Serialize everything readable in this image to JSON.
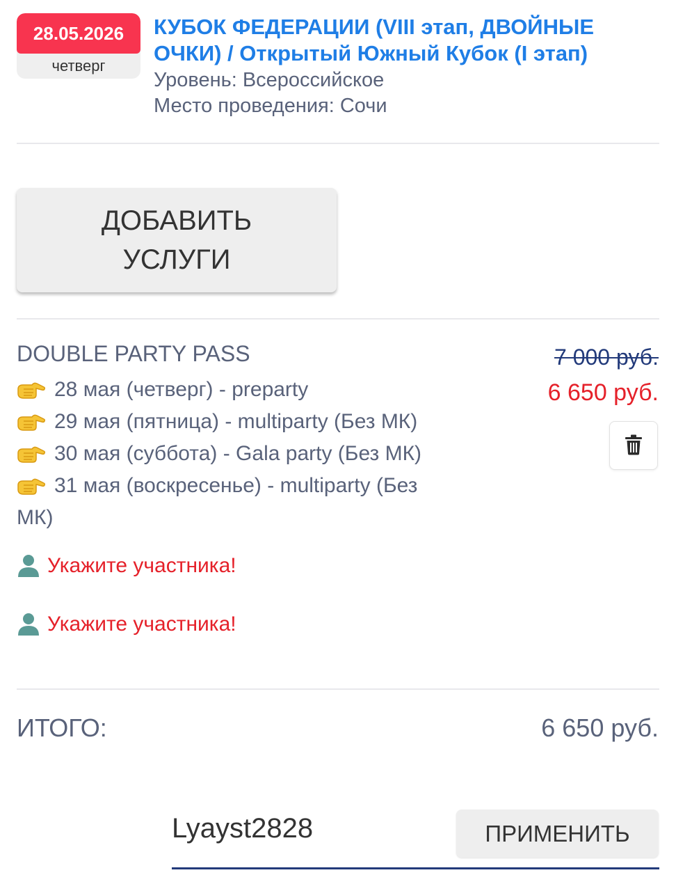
{
  "event": {
    "date": "28.05.2026",
    "weekday": "четверг",
    "title": "КУБОК ФЕДЕРАЦИИ (VIII этап, ДВОЙНЫЕ ОЧКИ) / Открытый Южный Кубок (I этап)",
    "level": "Уровень: Всероссийское",
    "venue": "Место проведения: Сочи",
    "colors": {
      "date_badge": "#f8344f",
      "title": "#1f7ee6"
    }
  },
  "add_services": {
    "label_line1": "ДОБАВИТЬ",
    "label_line2": "УСЛУГИ"
  },
  "item": {
    "name": "DOUBLE PARTY PASS",
    "lines": [
      "28 мая (четверг) - preparty",
      "29 мая (пятница) - multiparty (Без МК)",
      "30 мая (суббота) - Gala party (Без МК)",
      "31 мая (воскресенье) - multiparty (Без",
      "МК)"
    ],
    "line_icon": "pointing-hand-icon",
    "old_price": "7 000 руб.",
    "new_price": "6 650 руб.",
    "delete_icon": "trash-icon",
    "participants": [
      {
        "icon": "person-icon",
        "text": "Укажите участника!"
      },
      {
        "icon": "person-icon",
        "text": "Укажите участника!"
      }
    ],
    "colors": {
      "old_price": "#223a7a",
      "new_price": "#e5212a",
      "warning": "#e5212a"
    }
  },
  "total": {
    "label": "ИТОГО:",
    "value": "6 650 руб."
  },
  "promo": {
    "value": "Lyayst2828",
    "apply_label": "ПРИМЕНИТЬ"
  }
}
